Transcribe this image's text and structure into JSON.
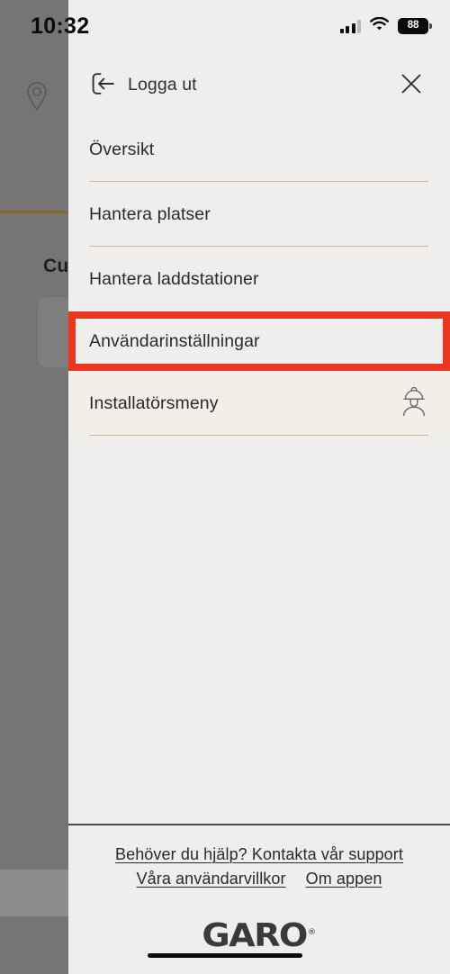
{
  "status_bar": {
    "time": "10:32",
    "battery_level": "88",
    "signal_icon": "cellular-signal-icon",
    "wifi_icon": "wifi-icon",
    "battery_icon": "battery-icon"
  },
  "background_app": {
    "location_pin_icon": "location-pin-icon",
    "partial_title": "Cu",
    "device_card_label": ""
  },
  "drawer": {
    "logout_label": "Logga ut",
    "logout_icon": "logout-arrow-icon",
    "close_icon": "close-x-icon",
    "menu_items": [
      {
        "label": "Översikt",
        "divider": true,
        "highlighted": false,
        "icon": ""
      },
      {
        "label": "Hantera platser",
        "divider": true,
        "highlighted": false,
        "icon": ""
      },
      {
        "label": "Hantera laddstationer",
        "divider": false,
        "highlighted": false,
        "icon": ""
      },
      {
        "label": "Användarinställningar",
        "divider": false,
        "highlighted": true,
        "icon": ""
      },
      {
        "label": "Installatörsmeny",
        "divider": true,
        "highlighted": false,
        "icon": "installer-helmet-icon"
      }
    ]
  },
  "footer": {
    "support_link": "Behöver du hjälp? Kontakta vår support",
    "terms_link": "Våra användarvillkor",
    "about_link": "Om appen",
    "logo_text": "GARO",
    "logo_trademark": "®"
  },
  "colors": {
    "panel_bg": "#efeeec",
    "overlay": "#757575",
    "divider": "#c9bfa8",
    "highlight_red": "#ec3620",
    "installer_row_bg": "#f2efe9",
    "text": "#2c2a29"
  }
}
